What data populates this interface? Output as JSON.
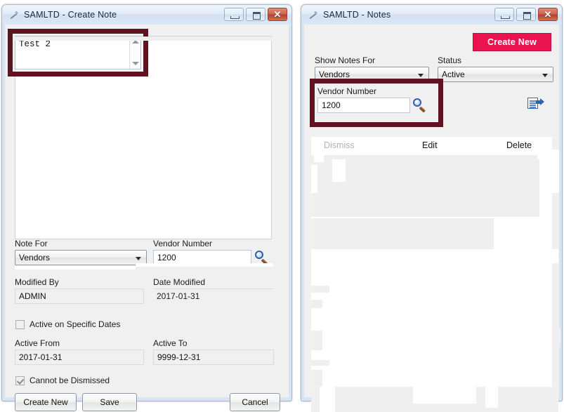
{
  "create_note_window": {
    "title": "SAMLTD - Create Note",
    "icon": "pencil-icon",
    "window_buttons": {
      "minimize": "minimize-icon",
      "maximize": "maximize-icon",
      "close": "✕"
    },
    "note_text": "Test  2",
    "fields": {
      "note_for_label": "Note For",
      "note_for_value": "Vendors",
      "vendor_number_label": "Vendor Number",
      "vendor_number_value": "1200",
      "modified_by_label": "Modified By",
      "modified_by_value": "ADMIN",
      "date_modified_label": "Date Modified",
      "date_modified_value": "2017-01-31",
      "active_from_label": "Active From",
      "active_from_value": "2017-01-31",
      "active_to_label": "Active To",
      "active_to_value": "9999-12-31"
    },
    "checkboxes": {
      "active_on_specific_dates_label": "Active on Specific Dates",
      "active_on_specific_dates_checked": false,
      "cannot_be_dismissed_label": "Cannot be Dismissed",
      "cannot_be_dismissed_checked": true
    },
    "buttons": {
      "create_new": "Create New",
      "save": "Save",
      "cancel": "Cancel"
    },
    "finder_icon": "magnifier-icon"
  },
  "notes_window": {
    "title": "SAMLTD - Notes",
    "icon": "pencil-icon",
    "window_buttons": {
      "minimize": "minimize-icon",
      "maximize": "maximize-icon",
      "close": "✕"
    },
    "create_new_button": "Create New",
    "filters": {
      "show_notes_for_label": "Show Notes For",
      "show_notes_for_value": "Vendors",
      "status_label": "Status",
      "status_value": "Active",
      "vendor_number_label": "Vendor Number",
      "vendor_number_value": "1200"
    },
    "finder_icon": "magnifier-icon",
    "export_icon": "export-icon",
    "list_headers": {
      "dismiss": "Dismiss",
      "edit": "Edit",
      "delete": "Delete"
    },
    "list_rows": []
  },
  "highlights": {
    "color": "#5e1320",
    "regions": [
      "note-text-area",
      "vendor-number-filter"
    ]
  }
}
